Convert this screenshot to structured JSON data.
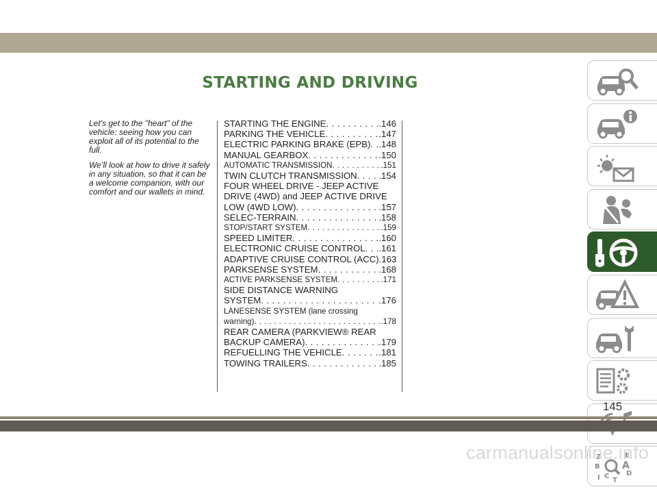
{
  "header": {
    "title": "STARTING AND DRIVING"
  },
  "intro": {
    "paragraphs": [
      "Let’s get to the \"heart\" of the vehicle: seeing how you can exploit all of its potential to the full.",
      "We’ll look at how to drive it safely in any situation, so that it can be a welcome companion, with our comfort and our wallets in mind."
    ]
  },
  "toc": [
    {
      "lines": [
        "STARTING THE ENGINE"
      ],
      "page": "146"
    },
    {
      "lines": [
        "PARKING THE VEHICLE"
      ],
      "page": "147"
    },
    {
      "lines": [
        "ELECTRIC PARKING BRAKE (EPB)"
      ],
      "page": "148"
    },
    {
      "lines": [
        "MANUAL GEARBOX"
      ],
      "page": "150"
    },
    {
      "lines": [
        "AUTOMATIC TRANSMISSION"
      ],
      "page": "151"
    },
    {
      "lines": [
        "TWIN CLUTCH TRANSMISSION"
      ],
      "page": "154"
    },
    {
      "lines": [
        "FOUR WHEEL DRIVE - JEEP ACTIVE",
        "DRIVE (4WD) and JEEP ACTIVE DRIVE",
        "LOW (4WD LOW)"
      ],
      "page": "157"
    },
    {
      "lines": [
        "SELEC-TERRAIN"
      ],
      "page": "158"
    },
    {
      "lines": [
        "STOP/START SYSTEM"
      ],
      "page": "159"
    },
    {
      "lines": [
        "SPEED LIMITER"
      ],
      "page": "160"
    },
    {
      "lines": [
        "ELECTRONIC CRUISE CONTROL"
      ],
      "page": "161"
    },
    {
      "lines": [
        "ADAPTIVE CRUISE CONTROL (ACC)"
      ],
      "page": "163"
    },
    {
      "lines": [
        "PARKSENSE SYSTEM"
      ],
      "page": "168"
    },
    {
      "lines": [
        "ACTIVE PARKSENSE SYSTEM"
      ],
      "page": "171"
    },
    {
      "lines": [
        "SIDE DISTANCE WARNING",
        "SYSTEM"
      ],
      "page": "176"
    },
    {
      "lines": [
        "LANESENSE SYSTEM (lane crossing",
        "warning)"
      ],
      "page": "178"
    },
    {
      "lines": [
        "REAR CAMERA (PARKVIEW® REAR",
        "BACKUP CAMERA)"
      ],
      "page": "179"
    },
    {
      "lines": [
        "REFUELLING THE VEHICLE"
      ],
      "page": "181"
    },
    {
      "lines": [
        "TOWING TRAILERS"
      ],
      "page": "185"
    }
  ],
  "sidebar": {
    "tabs": [
      {
        "icon": "car-magnifier-icon",
        "active": false
      },
      {
        "icon": "car-info-icon",
        "active": false
      },
      {
        "icon": "warning-light-envelope-icon",
        "active": false
      },
      {
        "icon": "person-seatbelt-icon",
        "active": false
      },
      {
        "icon": "key-steering-wheel-icon",
        "active": true
      },
      {
        "icon": "car-warning-triangle-icon",
        "active": false
      },
      {
        "icon": "car-wrench-icon",
        "active": false
      },
      {
        "icon": "specifications-gear-icon",
        "active": false
      },
      {
        "icon": "multimedia-music-icon",
        "active": false
      },
      {
        "icon": "alphabetical-index-icon",
        "active": false
      }
    ],
    "index_letters": [
      "Z",
      "E",
      "B",
      "A",
      "C",
      "D",
      "I",
      "T"
    ]
  },
  "footer": {
    "page_number": "145"
  },
  "watermark": "carmanualsonline.info",
  "colors": {
    "title": "#4d7c43",
    "active_tab": "#2d5a2a",
    "band": "#b0a792",
    "icon": "#8c8c8c"
  }
}
